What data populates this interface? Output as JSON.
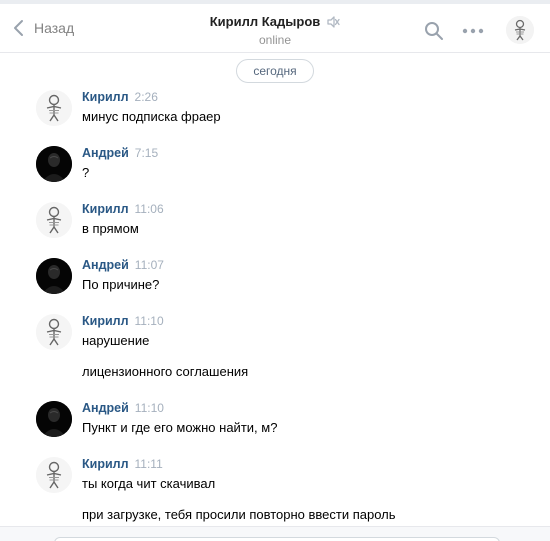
{
  "header": {
    "back_label": "Назад",
    "title": "Кирилл Кадыров",
    "status": "online",
    "icons": {
      "back": "chevron-left-icon",
      "mute": "muted-speaker-icon",
      "search": "search-icon",
      "more": "more-icon"
    }
  },
  "date_separator": "сегодня",
  "messages": [
    {
      "author": "Кирилл",
      "time": "2:26",
      "lines": [
        "минус подписка фраер"
      ]
    },
    {
      "author": "Андрей",
      "time": "7:15",
      "lines": [
        "?"
      ]
    },
    {
      "author": "Кирилл",
      "time": "11:06",
      "lines": [
        "в прямом"
      ]
    },
    {
      "author": "Андрей",
      "time": "11:07",
      "lines": [
        "По причине?"
      ]
    },
    {
      "author": "Кирилл",
      "time": "11:10",
      "lines": [
        "нарушение",
        "лицензионного соглашения"
      ]
    },
    {
      "author": "Андрей",
      "time": "11:10",
      "lines": [
        "Пункт и где его можно найти, м?"
      ]
    },
    {
      "author": "Кирилл",
      "time": "11:11",
      "lines": [
        "ты когда чит скачивал",
        "при загрузке, тебя просили повторно ввести пароль"
      ]
    }
  ],
  "colors": {
    "author": "#2a5885",
    "time": "#a5b0bd",
    "muted_text": "#828282",
    "border": "#e7e8ec"
  }
}
